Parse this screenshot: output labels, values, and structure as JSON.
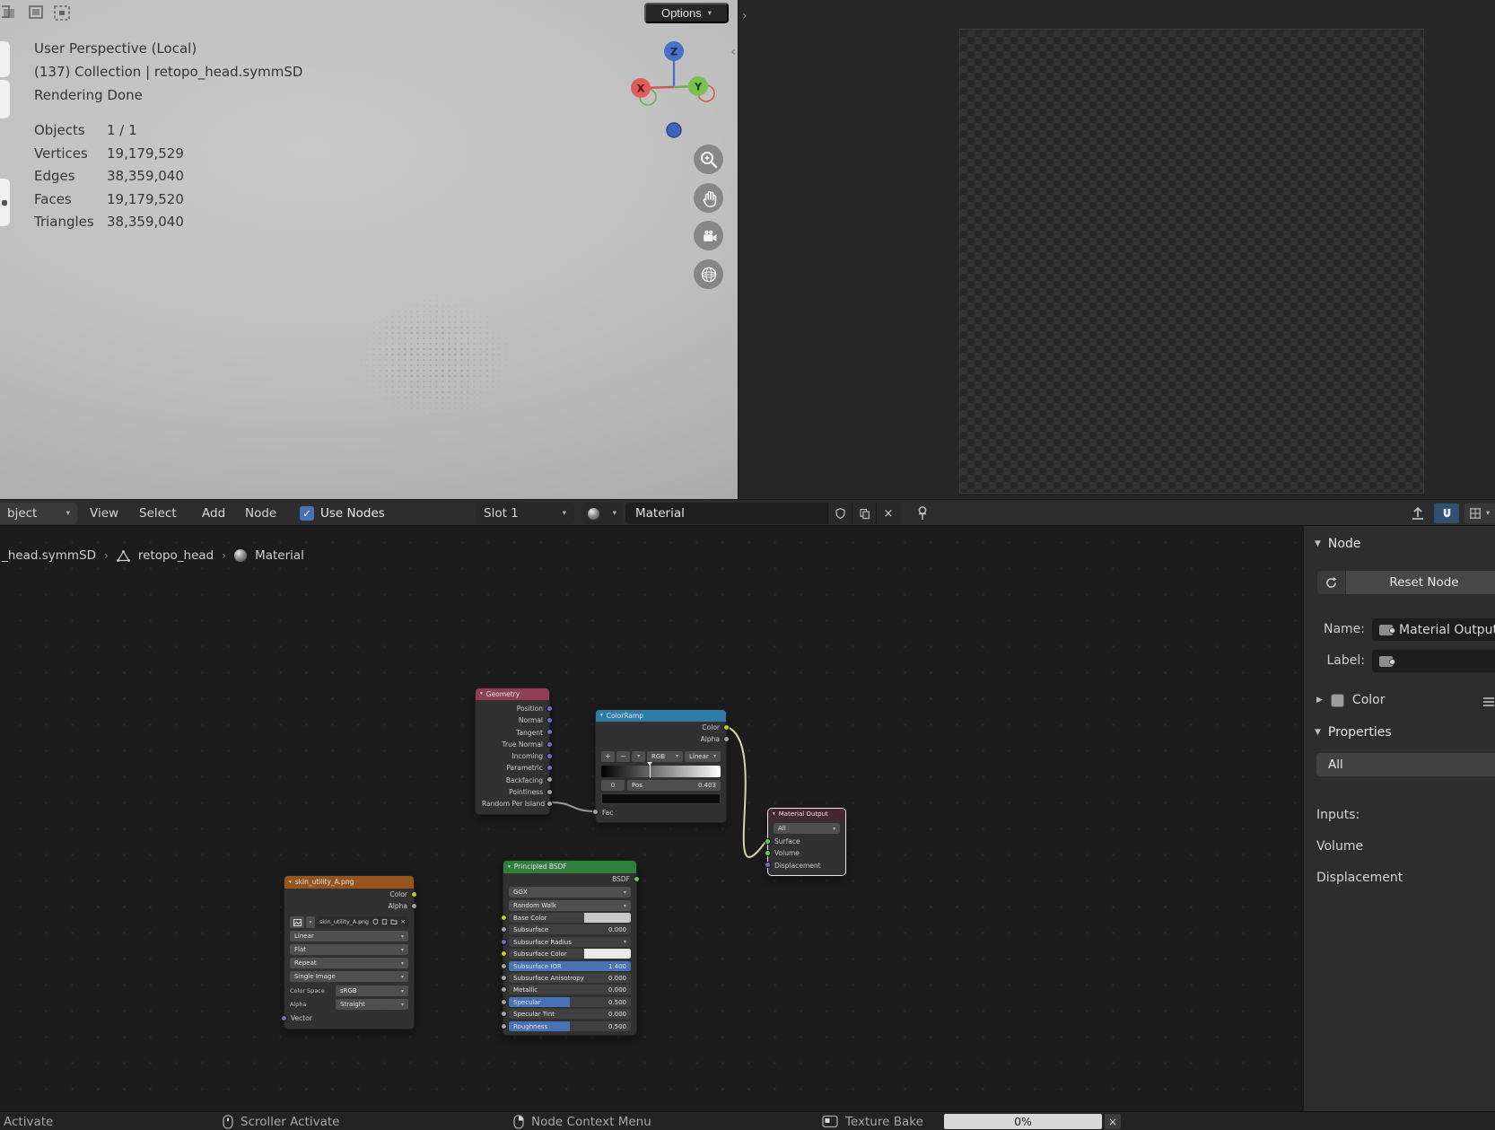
{
  "colors": {
    "slider_fill": "#4772b3",
    "base_color_swatch": "#c9c9c9",
    "subsurface_color_swatch": "#e9e9e9",
    "ramp_stop_color": "#0c0c0c"
  },
  "viewport": {
    "options_label": "Options",
    "overlay": {
      "perspective": "User Perspective (Local)",
      "collection": "(137) Collection | retopo_head.symmSD",
      "render_status": "Rendering Done",
      "stats": [
        {
          "label": "Objects",
          "value": "1 / 1"
        },
        {
          "label": "Vertices",
          "value": "19,179,529"
        },
        {
          "label": "Edges",
          "value": "38,359,040"
        },
        {
          "label": "Faces",
          "value": "19,179,520"
        },
        {
          "label": "Triangles",
          "value": "38,359,040"
        }
      ]
    },
    "gizmo": {
      "x_label": "X",
      "y_label": "Y",
      "z_label": "Z"
    }
  },
  "shader_header": {
    "object_menu": "bject",
    "menus": [
      "View",
      "Select",
      "Add",
      "Node"
    ],
    "use_nodes_label": "Use Nodes",
    "slot": "Slot 1",
    "material_name": "Material"
  },
  "breadcrumb": [
    "_head.symmSD",
    "retopo_head",
    "Material"
  ],
  "node_editor": {
    "nodes": {
      "geometry": {
        "title": "Geometry",
        "outputs": [
          "Position",
          "Normal",
          "Tangent",
          "True Normal",
          "Incoming",
          "Parametric",
          "Backfacing",
          "Pointiness",
          "Random Per Island"
        ]
      },
      "colorramp": {
        "title": "ColorRamp",
        "outputs": [
          "Color",
          "Alpha"
        ],
        "add_label": "+",
        "remove_label": "−",
        "color_mode": "RGB",
        "interpolation": "Linear",
        "stop_index": "0",
        "pos_label": "Pos",
        "pos_value": "0.403",
        "input": "Fac"
      },
      "material_output": {
        "title": "Material Output",
        "target": "All",
        "inputs": [
          "Surface",
          "Volume",
          "Displacement"
        ]
      },
      "principled": {
        "title": "Principled BSDF",
        "output": "BSDF",
        "distribution": "GGX",
        "subsurface_method": "Random Walk",
        "rows": [
          {
            "label": "Base Color"
          },
          {
            "label": "Subsurface",
            "value": "0.000"
          },
          {
            "label": "Subsurface Radius"
          },
          {
            "label": "Subsurface Color"
          },
          {
            "label": "Subsurface IOR",
            "value": "1.400",
            "fill": "100%"
          },
          {
            "label": "Subsurface Anisotropy",
            "value": "0.000"
          },
          {
            "label": "Metallic",
            "value": "0.000"
          },
          {
            "label": "Specular",
            "value": "0.500",
            "fill": "50%"
          },
          {
            "label": "Specular Tint",
            "value": "0.000"
          },
          {
            "label": "Roughness",
            "value": "0.500",
            "fill": "50%"
          }
        ]
      },
      "image_texture": {
        "title": "skin_utility_A.png",
        "outputs": [
          "Color",
          "Alpha"
        ],
        "image_name": "skin_utility_A.png",
        "dropdowns": [
          "Linear",
          "Flat",
          "Repeat",
          "Single Image"
        ],
        "color_space_label": "Color Space",
        "color_space": "sRGB",
        "alpha_label": "Alpha",
        "alpha_mode": "Straight",
        "input": "Vector"
      }
    }
  },
  "sidebar": {
    "node_section": "Node",
    "reset_button": "Reset Node",
    "name_label": "Name:",
    "name_value": "Material Output",
    "label_label": "Label:",
    "color_row": "Color",
    "properties_section": "Properties",
    "all_button": "All",
    "inputs_label": "Inputs:",
    "input_names": [
      "Volume",
      "Displacement"
    ]
  },
  "status_bar": {
    "items": [
      "Activate",
      "Scroller Activate",
      "Node Context Menu",
      "Texture Bake"
    ],
    "progress": "0%"
  }
}
